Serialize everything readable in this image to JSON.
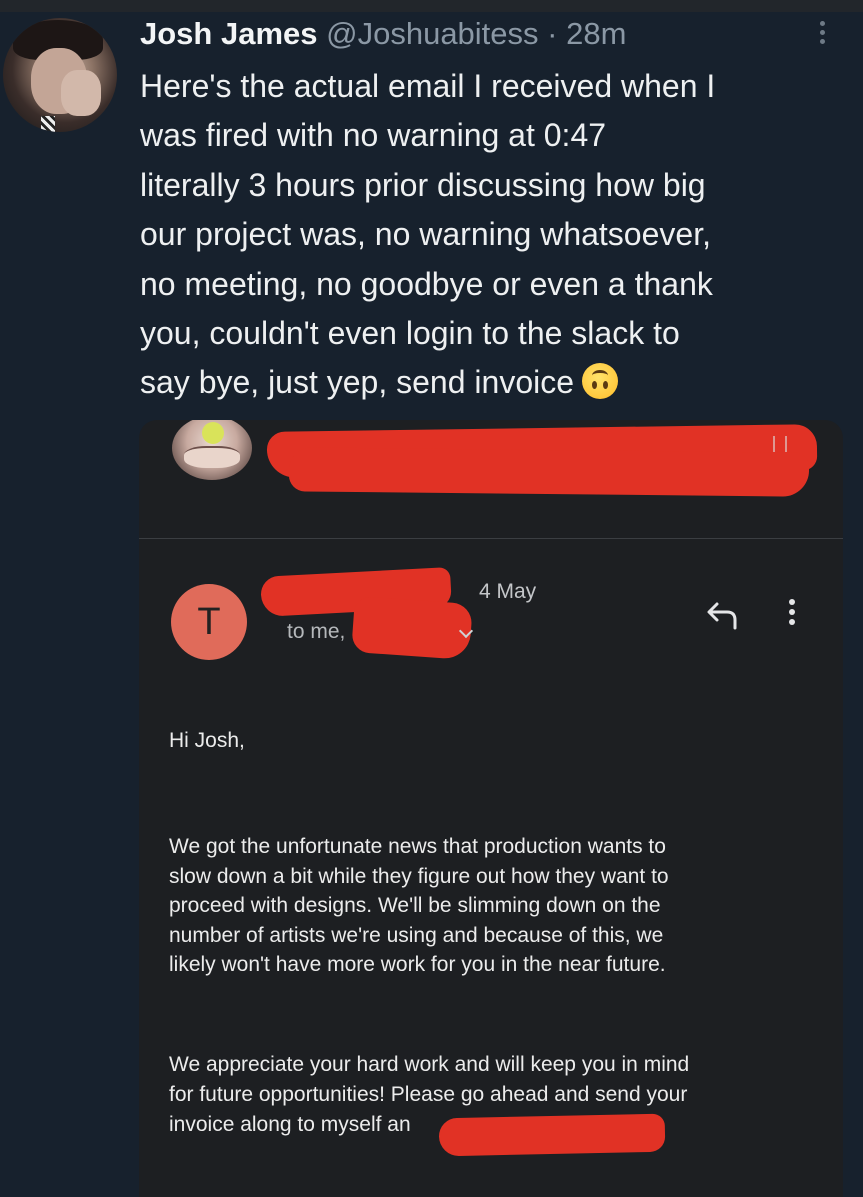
{
  "tweet": {
    "author_name": "Josh James",
    "author_handle": "@Joshuabitess",
    "separator": "·",
    "time_ago": "28m",
    "text_lines": [
      "Here's the actual email I received when I",
      "was fired with no warning at 0:47",
      "literally 3 hours prior discussing how big",
      "our project was, no warning whatsoever,",
      "no meeting, no goodbye or even a thank",
      "you, couldn't even login to the slack to",
      "say bye, just yep, send invoice"
    ],
    "emoji": "upside-down-face-emoji"
  },
  "email": {
    "sender_initial": "T",
    "date": "4 May",
    "recipient_label": "to me,",
    "greeting": "Hi Josh,",
    "paragraph1_lines": [
      "We got the unfortunate news that production wants to",
      "slow down a bit while they figure out how they want to",
      "proceed with designs. We'll be slimming down on the",
      "number of artists we're using and because of this, we",
      "likely won't have more work for you in the near future."
    ],
    "paragraph2_lines": [
      "We appreciate your hard work and will keep you in mind",
      "for future opportunities! Please go ahead and send your",
      "invoice along to myself an"
    ],
    "redaction_color": "#e13225",
    "sender_avatar_color": "#e06b5a"
  },
  "icons": [
    "more-options-icon",
    "reply-icon",
    "kebab-menu-icon",
    "chevron-down-icon"
  ]
}
